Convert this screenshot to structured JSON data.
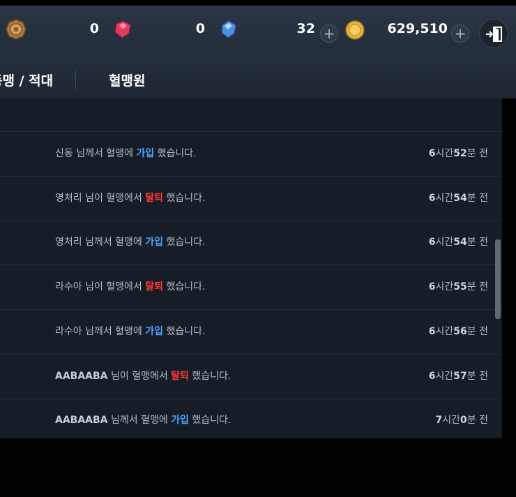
{
  "currency": {
    "medal_count": "",
    "red_gem_count": "0",
    "blue_gem_count": "0",
    "ticket_count": "32",
    "gold_count": "629,510"
  },
  "tabs": [
    {
      "label": "동맹 / 적대"
    },
    {
      "label": "혈맹원"
    }
  ],
  "log": {
    "word_members_join": "님께서 혈맹에",
    "word_members_leave": "님이 혈맹에서",
    "join": "가입",
    "leave": "탈퇴",
    "done": "했습니다.",
    "time_suffix_hour": "시간",
    "time_suffix_min": "분",
    "time_suffix_ago": "전",
    "rows": [
      {
        "name": "신동",
        "action": "join",
        "hours": "6",
        "minutes": "52",
        "bold": false
      },
      {
        "name": "영처리",
        "action": "leave",
        "hours": "6",
        "minutes": "54",
        "bold": false
      },
      {
        "name": "영처리",
        "action": "join",
        "hours": "6",
        "minutes": "54",
        "bold": false
      },
      {
        "name": "라수아",
        "action": "leave",
        "hours": "6",
        "minutes": "55",
        "bold": false
      },
      {
        "name": "라수아",
        "action": "join",
        "hours": "6",
        "minutes": "56",
        "bold": false
      },
      {
        "name": "AABAABA",
        "action": "leave",
        "hours": "6",
        "minutes": "57",
        "bold": true
      },
      {
        "name": "AABAABA",
        "action": "join",
        "hours": "7",
        "minutes": "0",
        "bold": true
      }
    ]
  },
  "colors": {
    "join": "#4aa3ff",
    "leave": "#ff3b2f"
  }
}
